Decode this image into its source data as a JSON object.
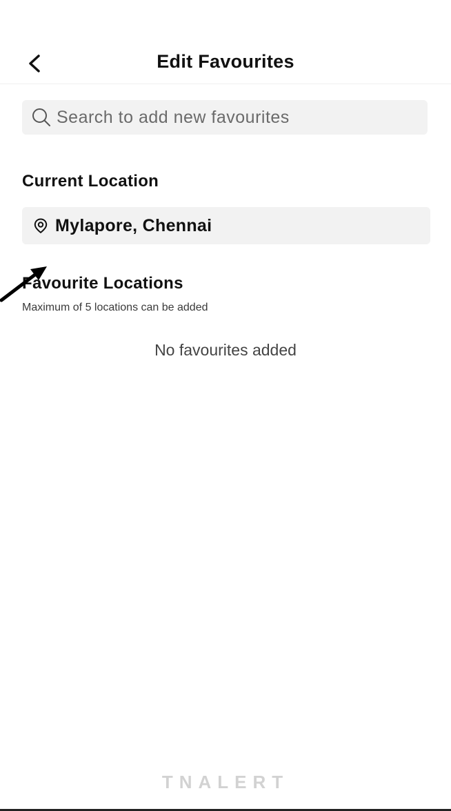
{
  "header": {
    "title": "Edit Favourites",
    "back_icon": "chevron-left-icon"
  },
  "search": {
    "placeholder": "Search to add new favourites",
    "icon": "search-icon"
  },
  "current_location": {
    "heading": "Current Location",
    "value": "Mylapore, Chennai",
    "icon": "location-pin-icon"
  },
  "favourites": {
    "heading": "Favourite Locations",
    "subtext": "Maximum of 5 locations can be added",
    "empty_message": "No favourites added"
  },
  "brand": {
    "name": "TNALERT"
  },
  "colors": {
    "field_background": "#f2f2f2",
    "text_primary": "#111111",
    "brand_text": "#d2d2d2"
  }
}
